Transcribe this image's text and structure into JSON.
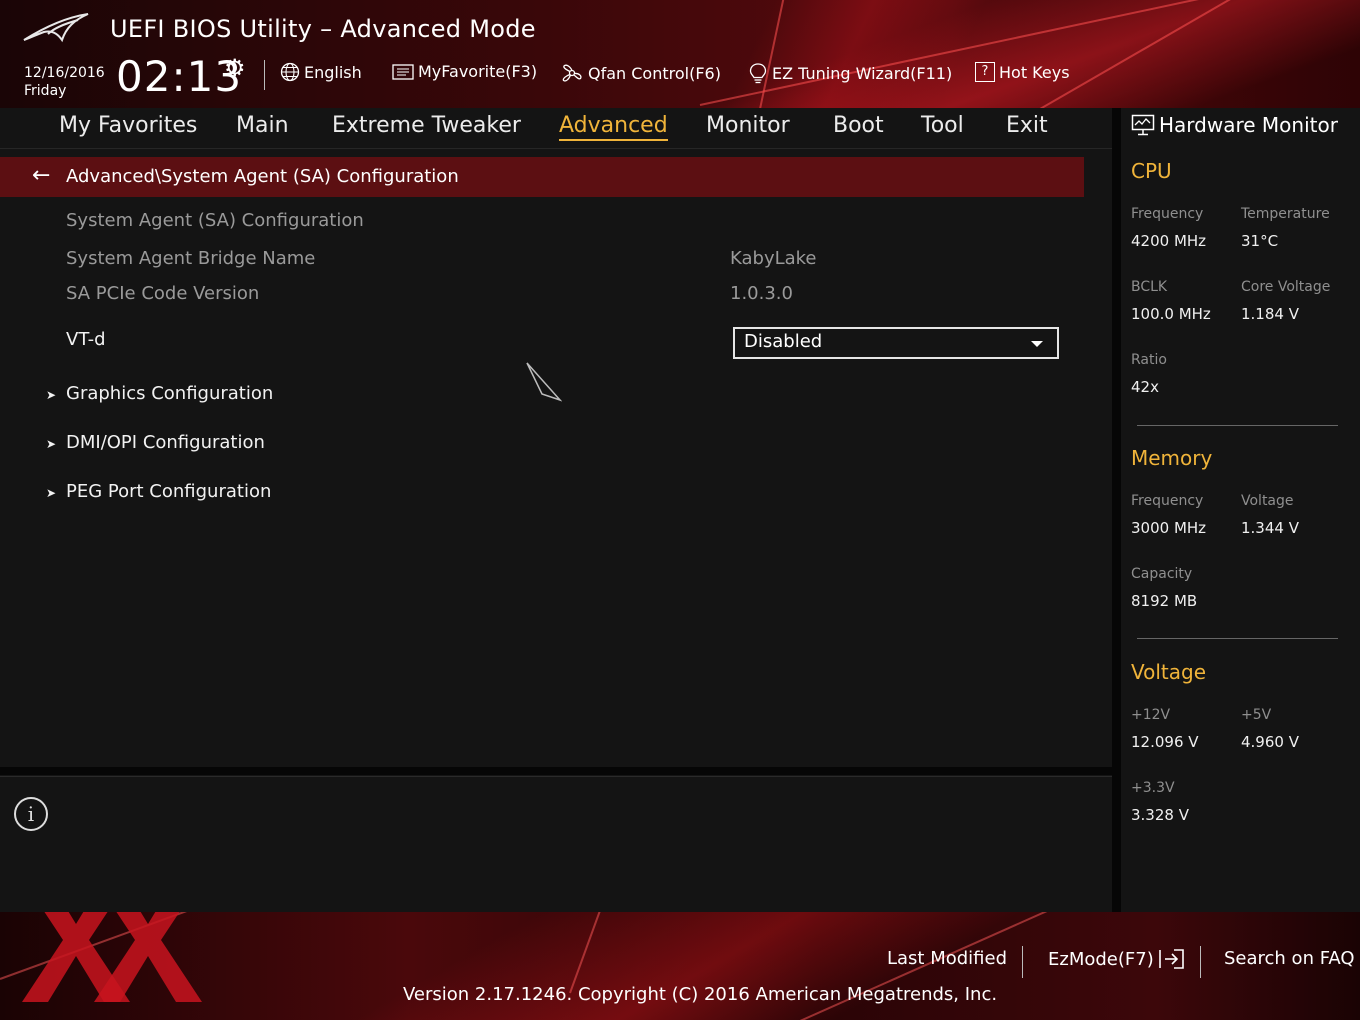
{
  "header": {
    "title": "UEFI BIOS Utility – Advanced Mode",
    "date": "12/16/2016",
    "day": "Friday",
    "time": "02:13",
    "language": "English",
    "my_favorite": "MyFavorite(F3)",
    "qfan": "Qfan Control(F6)",
    "ez_tuning": "EZ Tuning Wizard(F11)",
    "hot_keys": "Hot Keys"
  },
  "menu": {
    "items": [
      "My Favorites",
      "Main",
      "Extreme Tweaker",
      "Advanced",
      "Monitor",
      "Boot",
      "Tool",
      "Exit"
    ],
    "active": "Advanced"
  },
  "main": {
    "breadcrumb": "Advanced\\System Agent (SA) Configuration",
    "section_title": "System Agent (SA) Configuration",
    "rows": [
      {
        "label": "System Agent Bridge Name",
        "value": "KabyLake"
      },
      {
        "label": "SA PCIe Code Version",
        "value": "1.0.3.0"
      }
    ],
    "vtd": {
      "label": "VT-d",
      "value": "Disabled"
    },
    "submenus": [
      "Graphics Configuration",
      "DMI/OPI Configuration",
      "PEG Port Configuration"
    ]
  },
  "hw_monitor": {
    "title": "Hardware Monitor",
    "cpu": {
      "heading": "CPU",
      "frequency_label": "Frequency",
      "frequency": "4200 MHz",
      "temperature_label": "Temperature",
      "temperature": "31°C",
      "bclk_label": "BCLK",
      "bclk": "100.0 MHz",
      "core_voltage_label": "Core Voltage",
      "core_voltage": "1.184 V",
      "ratio_label": "Ratio",
      "ratio": "42x"
    },
    "memory": {
      "heading": "Memory",
      "frequency_label": "Frequency",
      "frequency": "3000 MHz",
      "voltage_label": "Voltage",
      "voltage": "1.344 V",
      "capacity_label": "Capacity",
      "capacity": "8192 MB"
    },
    "voltage": {
      "heading": "Voltage",
      "v12_label": "+12V",
      "v12": "12.096 V",
      "v5_label": "+5V",
      "v5": "4.960 V",
      "v33_label": "+3.3V",
      "v33": "3.328 V"
    }
  },
  "footer": {
    "last_modified": "Last Modified",
    "ezmode": "EzMode(F7)",
    "search_faq": "Search on FAQ",
    "copyright": "Version 2.17.1246. Copyright (C) 2016 American Megatrends, Inc."
  },
  "colors": {
    "accent": "#f0b43a",
    "breadcrumb_bg": "#5c0f12",
    "background": "#141414",
    "brand_red": "#c8141e"
  }
}
